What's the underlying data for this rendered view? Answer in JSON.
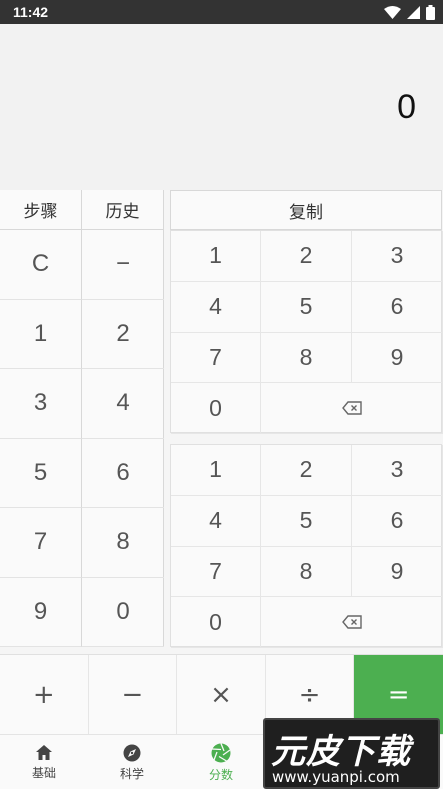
{
  "status_bar": {
    "time": "11:42"
  },
  "display": {
    "value": "0"
  },
  "tabs": [
    {
      "label": "步骤"
    },
    {
      "label": "历史"
    }
  ],
  "copy_button": {
    "label": "复制"
  },
  "left_keypad": [
    "C",
    "−",
    "1",
    "2",
    "3",
    "4",
    "5",
    "6",
    "7",
    "8",
    "9",
    "0"
  ],
  "numerator_pad": [
    "1",
    "2",
    "3",
    "4",
    "5",
    "6",
    "7",
    "8",
    "9",
    "0"
  ],
  "denominator_pad": [
    "1",
    "2",
    "3",
    "4",
    "5",
    "6",
    "7",
    "8",
    "9",
    "0"
  ],
  "operators": {
    "add": "+",
    "subtract": "−",
    "multiply": "×",
    "divide": "÷",
    "equals": "="
  },
  "bottom_nav": [
    {
      "label": "基础",
      "icon": "home-icon"
    },
    {
      "label": "科学",
      "icon": "compass-icon"
    },
    {
      "label": "分数",
      "icon": "aperture-icon",
      "active": true
    }
  ],
  "watermark": {
    "title": "元皮下载",
    "url": "www.yuanpi.com"
  },
  "colors": {
    "accent": "#4caf50",
    "status_bar": "#333333",
    "display_bg": "#f2f2f2"
  }
}
